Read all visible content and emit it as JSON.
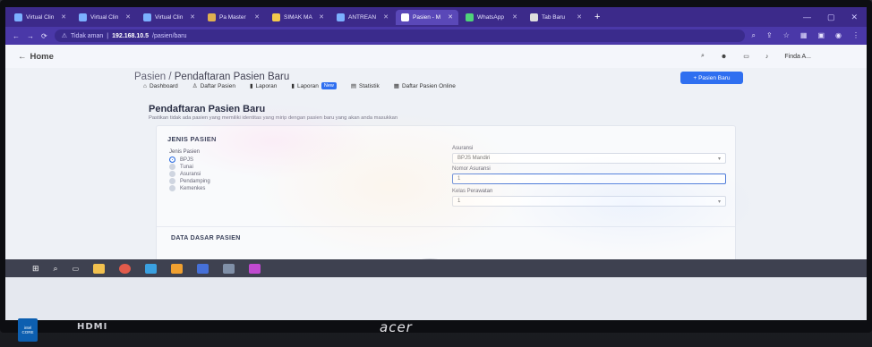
{
  "browser": {
    "tabs": [
      {
        "label": "Virtual Clin",
        "color": "#7bb0ff"
      },
      {
        "label": "Virtual Clin",
        "color": "#7bb0ff"
      },
      {
        "label": "Virtual Clin",
        "color": "#7bb0ff"
      },
      {
        "label": "Pa Master",
        "color": "#e0b050"
      },
      {
        "label": "SIMAK MA",
        "color": "#f2c94c"
      },
      {
        "label": "ANTREAN",
        "color": "#7bb0ff"
      },
      {
        "label": "Pasien - M",
        "color": "#ffffff"
      },
      {
        "label": "WhatsApp",
        "color": "#4fd37a"
      },
      {
        "label": "Tab Baru",
        "color": "#dddddd"
      }
    ],
    "url_prefix": "Tidak aman",
    "url_host": "192.168.10.5",
    "url_path": "/pasien/baru"
  },
  "app": {
    "home_label": "Home",
    "user_label": "Finda A...",
    "breadcrumb_root": "Pasien",
    "breadcrumb_current": "Pendaftaran Pasien Baru",
    "new_patient_button": "+ Pasien Baru",
    "nav": [
      {
        "label": "Dashboard"
      },
      {
        "label": "Daftar Pasien"
      },
      {
        "label": "Laporan"
      },
      {
        "label": "Laporan",
        "badge": "New"
      },
      {
        "label": "Statistik"
      },
      {
        "label": "Daftar Pasien Online"
      }
    ],
    "page_title": "Pendaftaran Pasien Baru",
    "page_subtitle": "Pastikan tidak ada pasien yang memiliki identitas yang mirip dengan pasien baru yang akan anda masukkan",
    "section_jenis": "JENIS PASIEN",
    "jenis_label": "Jenis Pasien",
    "jenis_options": [
      "BPJS",
      "Tunai",
      "Asuransi",
      "Pendamping",
      "Kemenkes"
    ],
    "jenis_selected": "BPJS",
    "asuransi_label": "Asuransi",
    "asuransi_value": "BPJS Mandiri",
    "nomor_label": "Nomor Asuransi",
    "nomor_value": "1",
    "kelas_label": "Kelas Perawatan",
    "kelas_value": "1",
    "section_data": "DATA DASAR PASIEN"
  },
  "bezel": {
    "hdmi": "HDMI",
    "brand": "acer",
    "intel_line1": "intel",
    "intel_line2": "CORE"
  }
}
